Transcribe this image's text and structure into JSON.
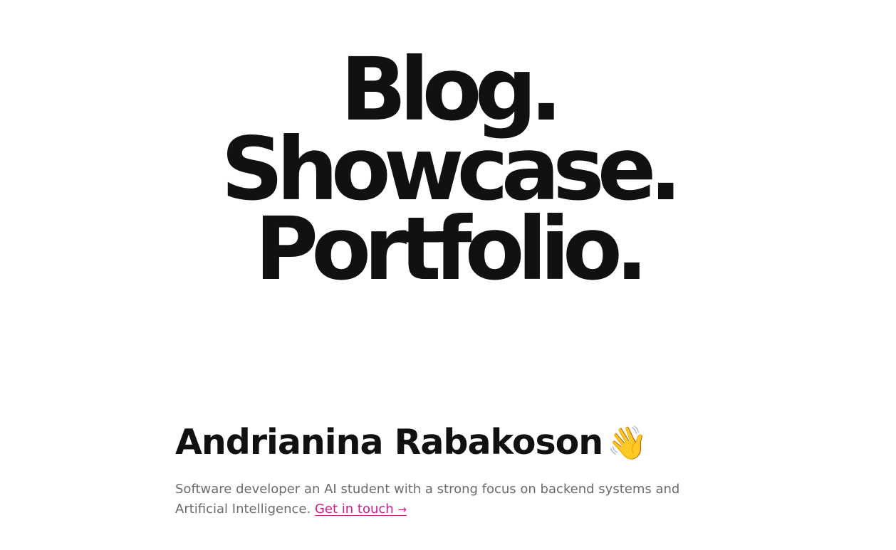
{
  "hero": {
    "lines": [
      "Blog.",
      "Showcase.",
      "Portfolio."
    ]
  },
  "intro": {
    "name": "Andrianina Rabakoson",
    "wave_emoji": "👋",
    "bio": "Software developer an AI student with a strong focus on backend systems and Artificial Intelligence.",
    "contact_label": "Get in touch",
    "contact_arrow": "→"
  },
  "colors": {
    "text": "#111111",
    "muted": "#6b6b6b",
    "link": "#c81e8c",
    "background": "#ffffff"
  }
}
